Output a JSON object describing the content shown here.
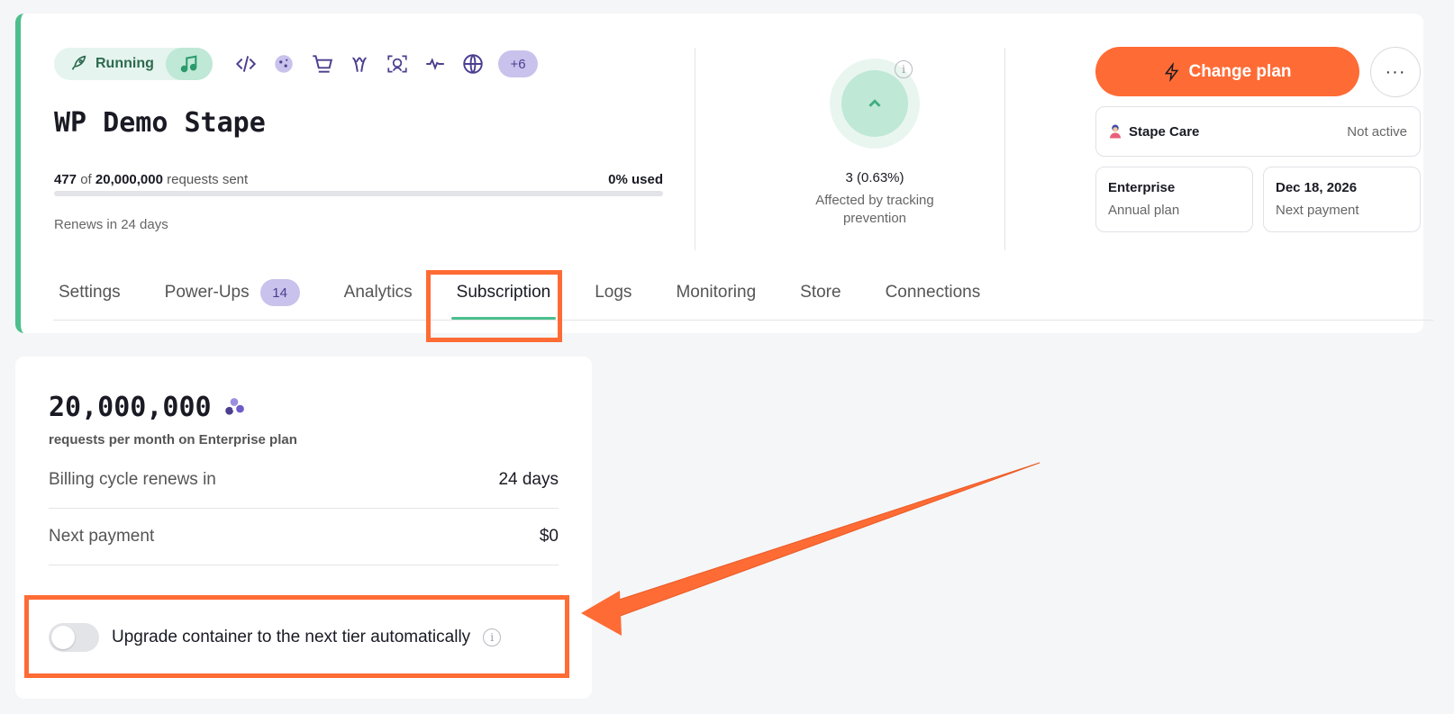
{
  "header": {
    "status": "Running",
    "more_badge": "+6",
    "title": "WP Demo Stape",
    "requests": {
      "sent": "477",
      "of": "of",
      "total": "20,000,000",
      "suffix": "requests sent",
      "used": "0% used",
      "progress_percent": 0
    },
    "renews": "Renews in 24 days",
    "icons": [
      "rocket-icon",
      "music-icon",
      "code-icon",
      "cookie-icon",
      "cart-icon",
      "meta-icon",
      "face-scan-icon",
      "heartbeat-icon",
      "globe-icon"
    ]
  },
  "tracking": {
    "value": "3 (0.63%)",
    "label": "Affected by tracking prevention"
  },
  "plan": {
    "change_plan_label": "Change plan",
    "more_label": "···",
    "care_label": "Stape Care",
    "care_status": "Not active",
    "plan_name": "Enterprise",
    "plan_period": "Annual plan",
    "next_date": "Dec 18, 2026",
    "next_label": "Next payment"
  },
  "tabs": [
    {
      "label": "Settings"
    },
    {
      "label": "Power-Ups",
      "count": "14"
    },
    {
      "label": "Analytics"
    },
    {
      "label": "Subscription",
      "active": true
    },
    {
      "label": "Logs"
    },
    {
      "label": "Monitoring"
    },
    {
      "label": "Store"
    },
    {
      "label": "Connections"
    }
  ],
  "subscription": {
    "requests": "20,000,000",
    "requests_sub": "requests per month on Enterprise plan",
    "billing_label": "Billing cycle renews in",
    "billing_value": "24 days",
    "payment_label": "Next payment",
    "payment_value": "$0",
    "auto_upgrade_label": "Upgrade container to the next tier automatically",
    "auto_upgrade_enabled": false
  },
  "colors": {
    "accent": "#ff6b35",
    "brand_green": "#4cbf8d",
    "badge_purple": "#c9c2ec"
  }
}
